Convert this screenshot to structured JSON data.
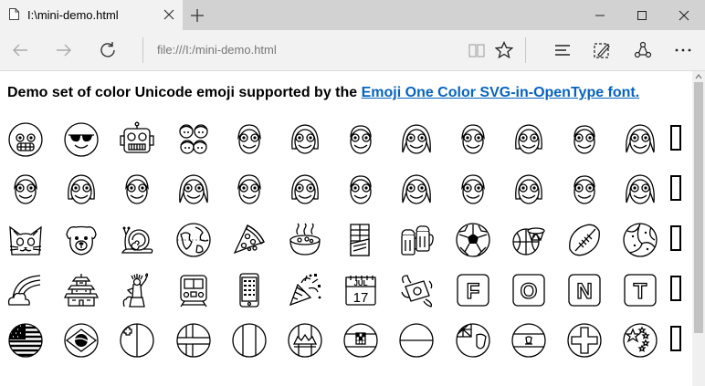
{
  "browser": {
    "tab_title": "I:\\mini-demo.html",
    "address": "file:///I:/mini-demo.html"
  },
  "icons": {
    "titlebar": [
      "file-icon",
      "close-tab-icon",
      "new-tab-icon",
      "minimize-icon",
      "maximize-icon",
      "close-window-icon"
    ],
    "navbar": [
      "back-arrow-icon",
      "forward-arrow-icon",
      "refresh-icon",
      "reading-view-icon",
      "favorite-star-icon",
      "hub-icon",
      "web-note-icon",
      "share-icon",
      "more-dots-icon"
    ]
  },
  "page": {
    "heading_text": "Demo set of color Unicode emoji supported by the ",
    "heading_link": "Emoji One Color SVG-in-OpenType font.",
    "link_color": "#0563c1",
    "emoji_rows": [
      [
        "grinning-face-braces",
        "smiling-face-sunglasses",
        "robot-face",
        "family",
        "boy",
        "girl",
        "man",
        "woman",
        "boy",
        "girl",
        "man",
        "woman"
      ],
      [
        "boy",
        "girl",
        "boy",
        "woman",
        "boy",
        "girl",
        "man",
        "woman",
        "boy",
        "girl",
        "man",
        "woman"
      ],
      [
        "cat-face",
        "dog-face",
        "snail",
        "globe",
        "pizza",
        "stew",
        "chocolate-bar",
        "beer-mugs",
        "soccer-ball",
        "basketball",
        "american-football",
        "volleyball"
      ],
      [
        "rainbow",
        "japanese-castle",
        "statue-of-liberty",
        "train",
        "mobile-phone",
        "party-popper",
        "calendar-jul-17",
        "money-with-wings",
        "letter-f",
        "letter-o",
        "letter-n",
        "letter-t"
      ],
      [
        "flag-us",
        "flag-brazil",
        "flag-malta",
        "flag-finland",
        "flag-generic",
        "flag-andorra",
        "flag-croatia",
        "flag-indonesia",
        "flag-montserrat",
        "flag-egypt",
        "flag-switzerland",
        "flag-china"
      ]
    ],
    "calendar": {
      "month": "JUL",
      "day": "17"
    },
    "letters": [
      "F",
      "O",
      "N",
      "T"
    ]
  }
}
